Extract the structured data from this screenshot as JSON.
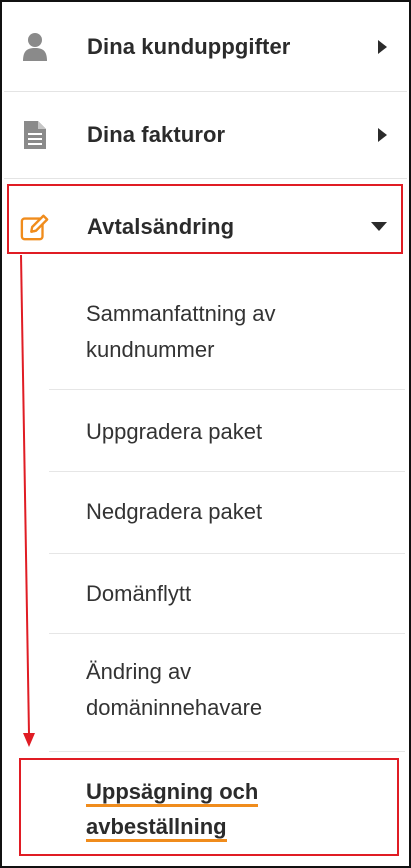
{
  "menu": {
    "items": [
      {
        "label": "Dina kunduppgifter",
        "icon": "user-icon",
        "chevron": "right"
      },
      {
        "label": "Dina fakturor",
        "icon": "document-icon",
        "chevron": "right"
      },
      {
        "label": "Avtalsändring",
        "icon": "edit-icon",
        "chevron": "down",
        "expanded": true
      }
    ],
    "subitems": [
      {
        "line1": "Sammanfattning av",
        "line2": "kundnummer"
      },
      {
        "line1": "Uppgradera paket"
      },
      {
        "line1": "Nedgradera paket"
      },
      {
        "line1": "Domänflytt"
      },
      {
        "line1": "Ändring av",
        "line2": "domäninnehavare"
      },
      {
        "line1": "Uppsägning och",
        "line2": "avbeställning",
        "active": true
      }
    ]
  },
  "colors": {
    "accent_orange": "#f08c1c",
    "annotation_red": "#e01c24",
    "icon_gray": "#8a8a8a",
    "text_dark": "#2b2b2b"
  }
}
